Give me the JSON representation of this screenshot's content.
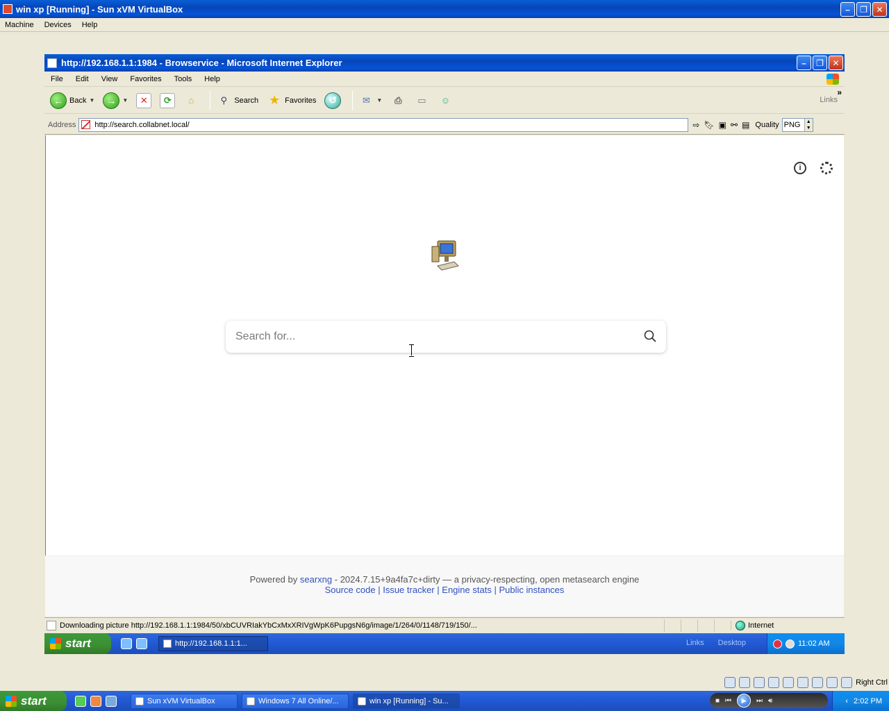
{
  "vbox": {
    "title": "win xp [Running] - Sun xVM VirtualBox",
    "menu": [
      "Machine",
      "Devices",
      "Help"
    ]
  },
  "ie": {
    "title": "http://192.168.1.1:1984 - Browservice - Microsoft Internet Explorer",
    "menu": [
      "File",
      "Edit",
      "View",
      "Favorites",
      "Tools",
      "Help"
    ],
    "toolbar": {
      "back_label": "Back",
      "search_label": "Search",
      "favorites_label": "Favorites",
      "links_label": "Links"
    },
    "address": {
      "label": "Address",
      "url": "http://search.collabnet.local/",
      "quality_label": "Quality",
      "quality_value": "PNG"
    },
    "status": {
      "text": "Downloading picture http://192.168.1.1:1984/50/xbCUVRIakYbCxMxXRIVgWpK6PupgsN6g/image/1/264/0/1148/719/150/...",
      "zone": "Internet"
    }
  },
  "page": {
    "search_placeholder": "Search for...",
    "footer": {
      "powered_prefix": "Powered by",
      "powered_link": "searxng",
      "powered_suffix": "- 2024.7.15+9a4fa7c+dirty — a privacy-respecting, open metasearch engine",
      "links": [
        "Source code",
        "Issue tracker",
        "Engine stats",
        "Public instances"
      ],
      "separator": "|"
    }
  },
  "guest_taskbar": {
    "start_label": "start",
    "task_label": "http://192.168.1.1:1...",
    "links_label": "Links",
    "desktop_label": "Desktop",
    "clock": "11:02 AM"
  },
  "vbox_status": {
    "host_key": "Right Ctrl"
  },
  "host_taskbar": {
    "start_label": "start",
    "tasks": [
      "Sun xVM VirtualBox",
      "Windows 7 All Online/...",
      "win xp [Running] - Su..."
    ],
    "clock": "2:02 PM"
  },
  "colors": {
    "xp_blue": "#0a5ed6",
    "start_green": "#3c9a3a",
    "link_blue": "#3050c0"
  }
}
